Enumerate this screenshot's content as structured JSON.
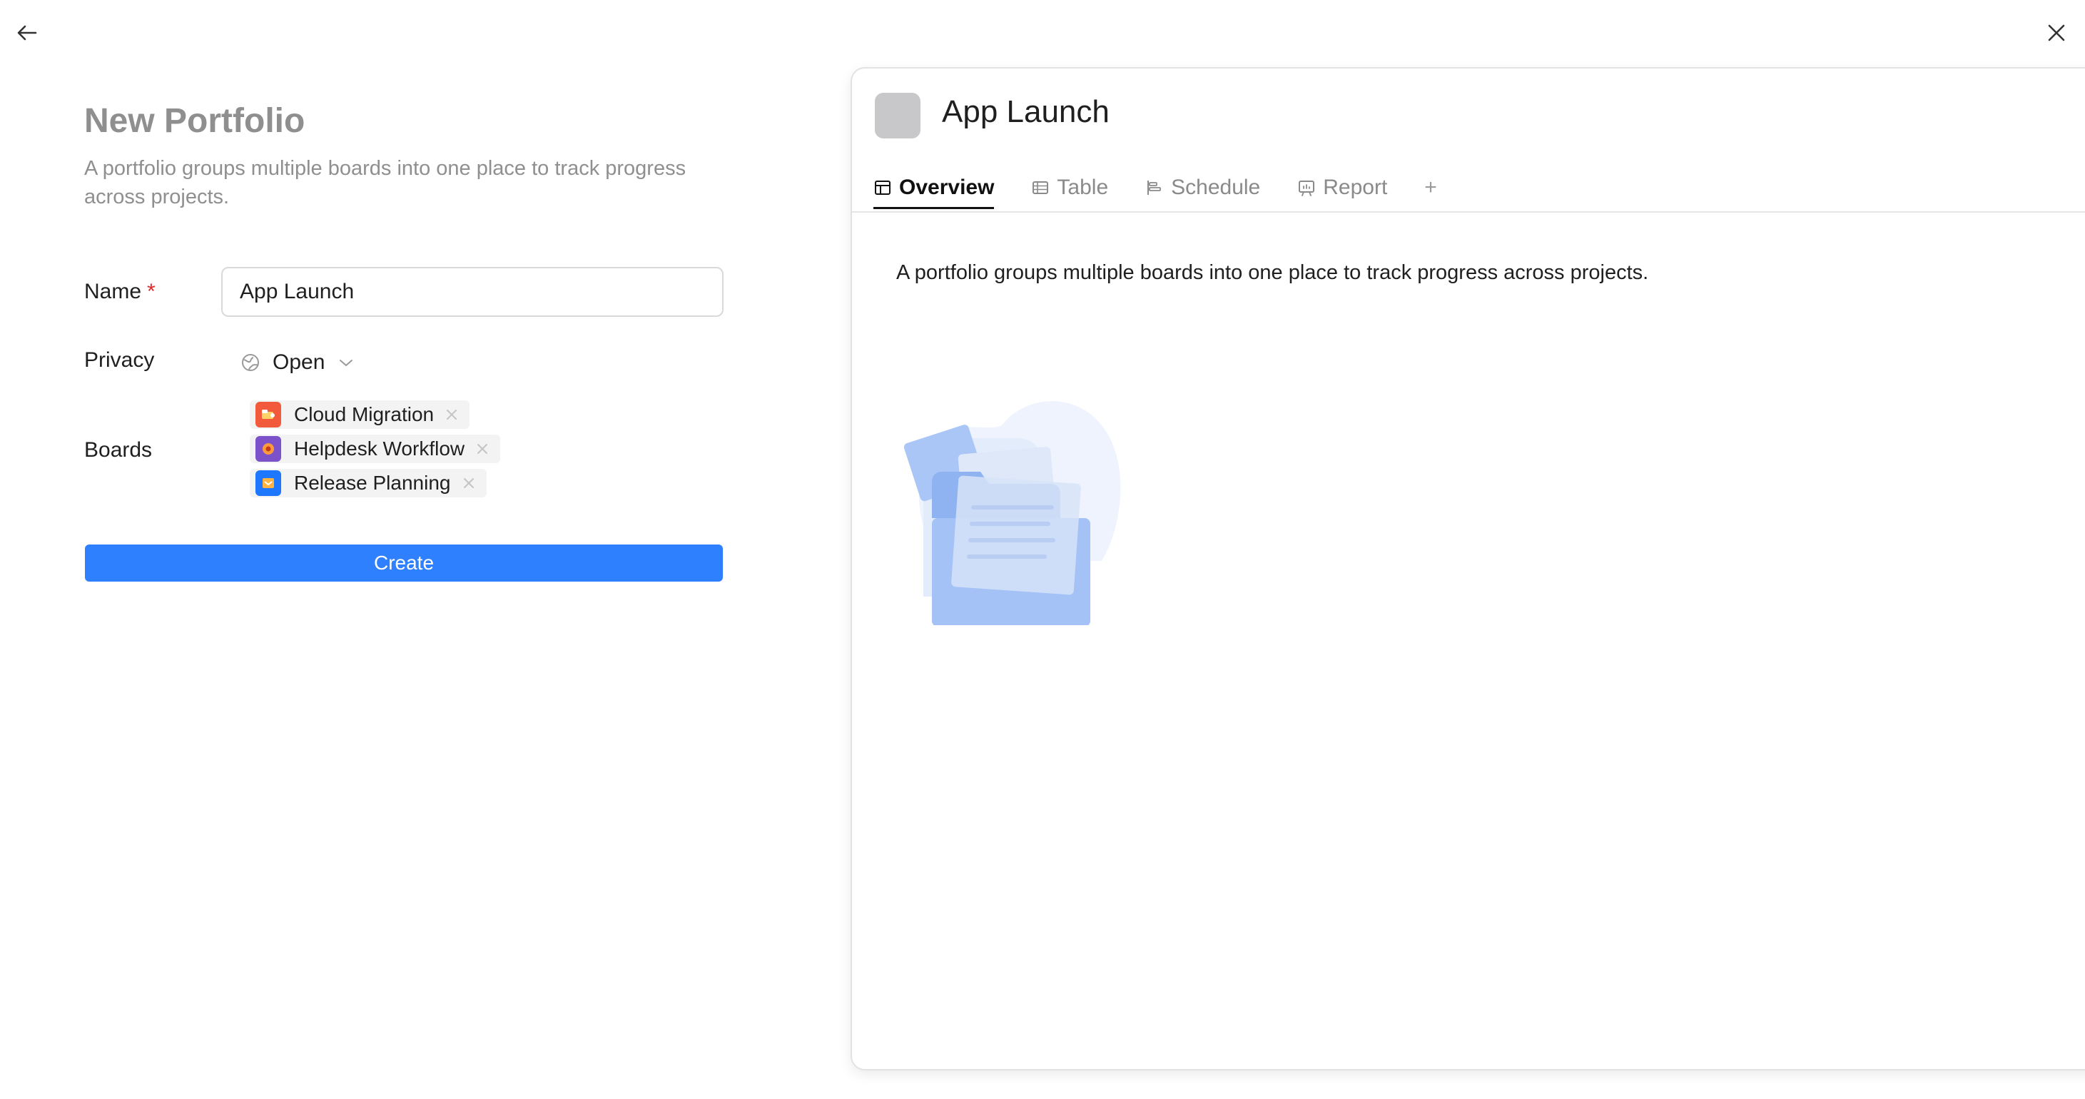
{
  "form": {
    "title": "New Portfolio",
    "description": "A portfolio groups multiple boards into one place to track progress across projects.",
    "name_label": "Name",
    "required_mark": "*",
    "name_value": "App Launch",
    "privacy_label": "Privacy",
    "privacy_value": "Open",
    "boards_label": "Boards",
    "boards": [
      {
        "name": "Cloud Migration",
        "color": "#f25a3c"
      },
      {
        "name": "Helpdesk Workflow",
        "color": "#7b52c9"
      },
      {
        "name": "Release Planning",
        "color": "#1e78ff"
      }
    ],
    "create_label": "Create"
  },
  "preview": {
    "title": "App Launch",
    "tabs": [
      {
        "label": "Overview",
        "icon": "overview-icon",
        "active": true
      },
      {
        "label": "Table",
        "icon": "table-icon"
      },
      {
        "label": "Schedule",
        "icon": "schedule-icon"
      },
      {
        "label": "Report",
        "icon": "report-icon"
      }
    ],
    "add_tab": "+",
    "description": "A portfolio groups multiple boards into one place to track progress across projects."
  },
  "colors": {
    "accent": "#2e80ff",
    "required": "#e02a2a",
    "muted_text": "#8f8f8f"
  }
}
